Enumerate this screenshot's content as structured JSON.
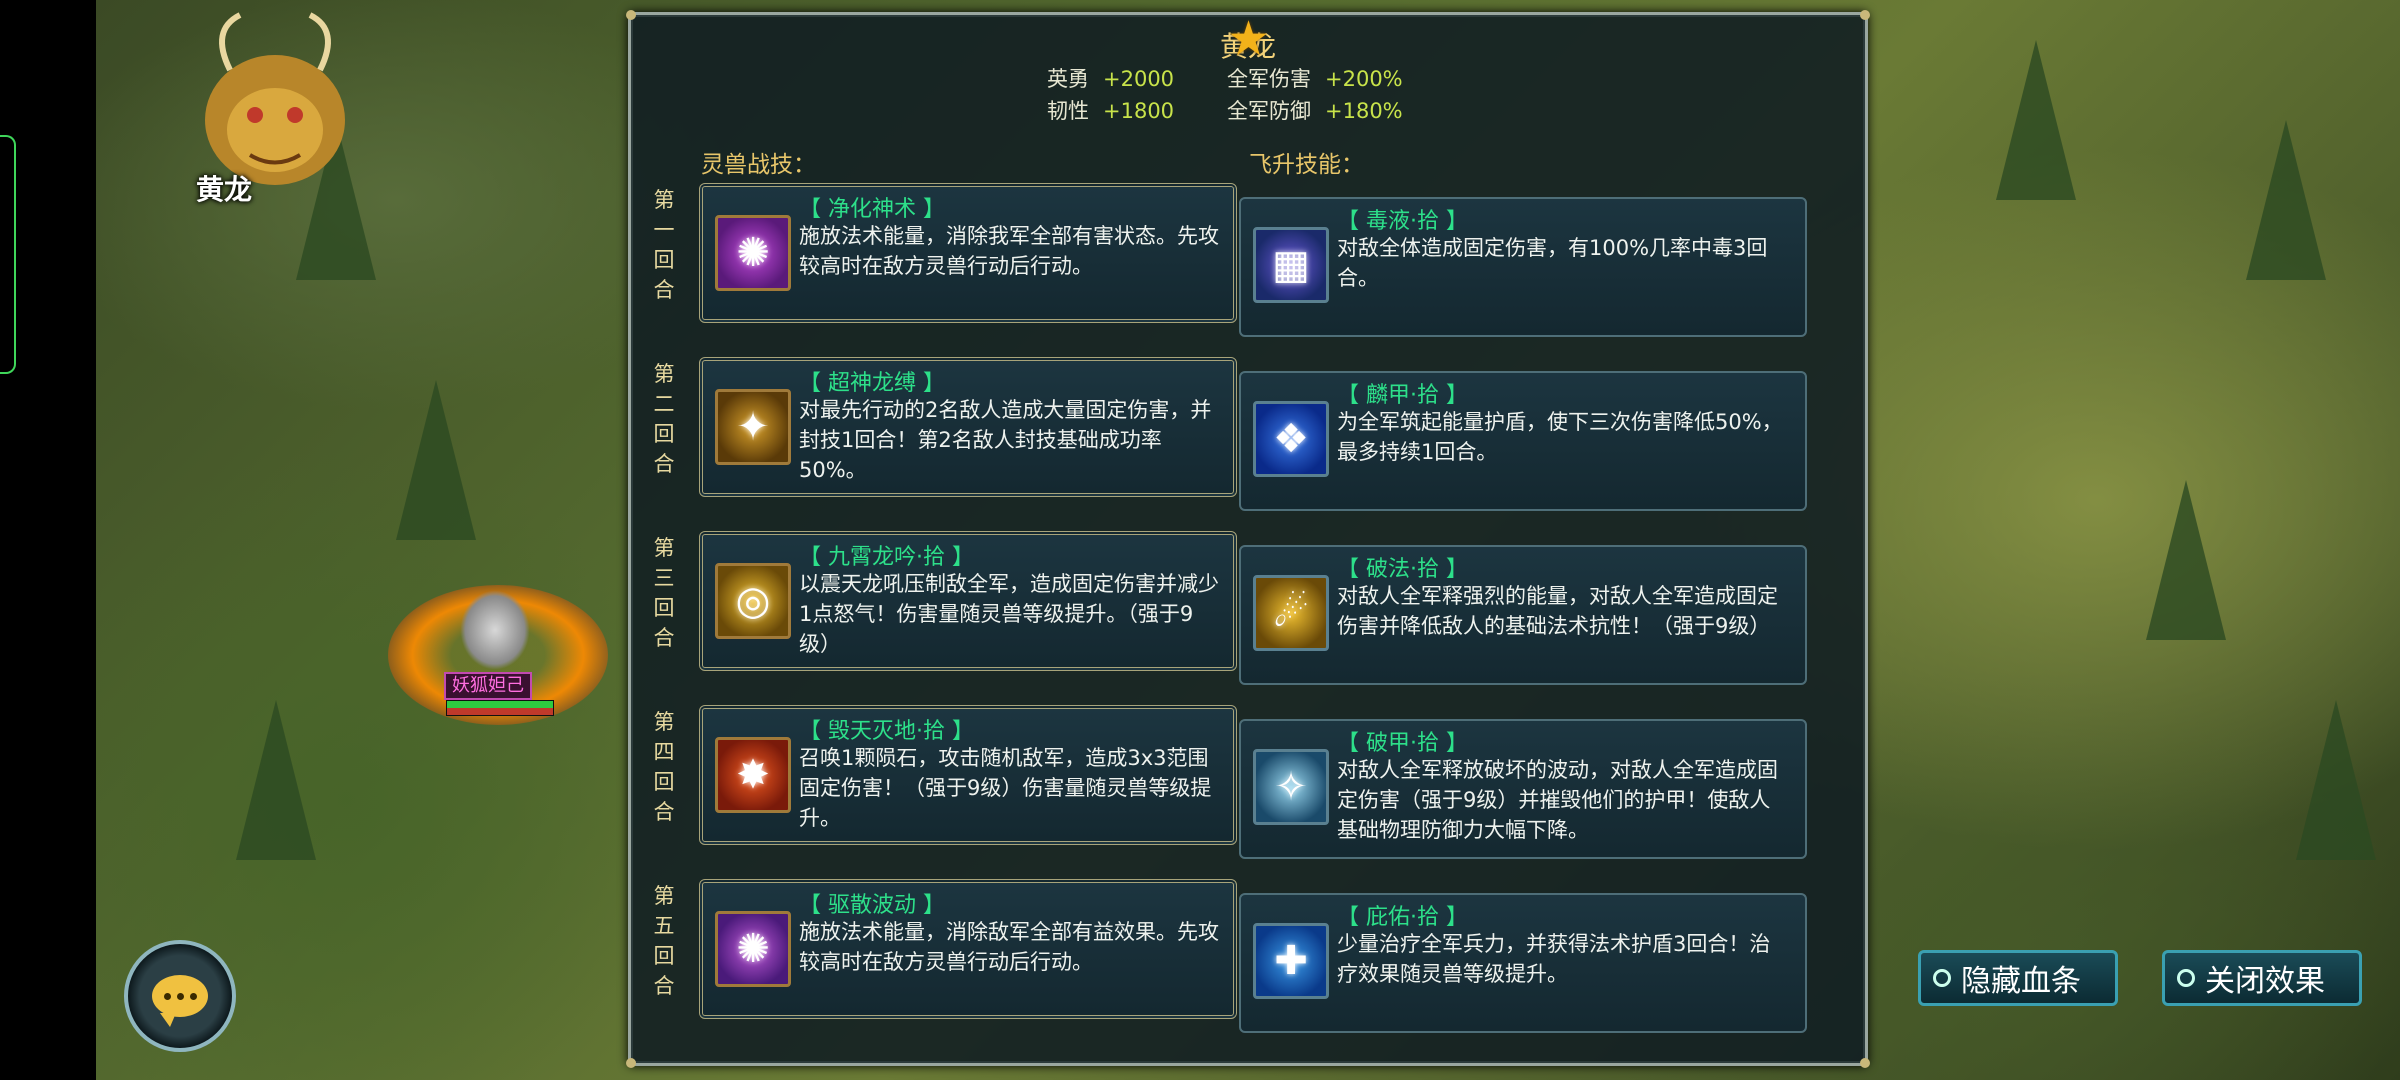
{
  "portrait": {
    "name": "黄龙"
  },
  "unit": {
    "label": "妖狐妲己"
  },
  "panel": {
    "title": "黄龙",
    "stats": [
      {
        "label": "英勇",
        "value": "+2000"
      },
      {
        "label": "全军伤害",
        "value": "+200%"
      },
      {
        "label": "韧性",
        "value": "+1800"
      },
      {
        "label": "全军防御",
        "value": "+180%"
      }
    ],
    "battle_label": "灵兽战技：",
    "ascend_label": "飞升技能：",
    "rounds": [
      {
        "round": [
          "第",
          "一",
          "回",
          "合"
        ],
        "battle": {
          "name": "【 净化神术 】",
          "desc": "施放法术能量，消除我军全部有害状态。先攻较高时在敌方灵兽行动后行动。"
        },
        "ascend": {
          "name": "【 毒液·拾 】",
          "desc": "对敌全体造成固定伤害，有100%几率中毒3回合。"
        }
      },
      {
        "round": [
          "第",
          "二",
          "回",
          "合"
        ],
        "battle": {
          "name": "【 超神龙缚 】",
          "desc": "对最先行动的2名敌人造成大量固定伤害，并封技1回合！第2名敌人封技基础成功率50%。"
        },
        "ascend": {
          "name": "【 麟甲·拾 】",
          "desc": "为全军筑起能量护盾，使下三次伤害降低50%，最多持续1回合。"
        }
      },
      {
        "round": [
          "第",
          "三",
          "回",
          "合"
        ],
        "battle": {
          "name": "【 九霄龙吟·拾 】",
          "desc": "以震天龙吼压制敌全军，造成固定伤害并减少1点怒气！伤害量随灵兽等级提升。（强于9级）"
        },
        "ascend": {
          "name": "【 破法·拾 】",
          "desc": "对敌人全军释强烈的能量，对敌人全军造成固定伤害并降低敌人的基础法术抗性！（强于9级）"
        }
      },
      {
        "round": [
          "第",
          "四",
          "回",
          "合"
        ],
        "battle": {
          "name": "【 毁天灭地·拾 】",
          "desc": "召唤1颗陨石，攻击随机敌军，造成3x3范围固定伤害！（强于9级）伤害量随灵兽等级提升。"
        },
        "ascend": {
          "name": "【 破甲·拾 】",
          "desc": "对敌人全军释放破坏的波动，对敌人全军造成固定伤害（强于9级）并摧毁他们的护甲！使敌人基础物理防御力大幅下降。"
        }
      },
      {
        "round": [
          "第",
          "五",
          "回",
          "合"
        ],
        "battle": {
          "name": "【 驱散波动 】",
          "desc": "施放法术能量，消除敌军全部有益效果。先攻较高时在敌方灵兽行动后行动。"
        },
        "ascend": {
          "name": "【 庇佑·拾 】",
          "desc": "少量治疗全军兵力，并获得法术护盾3回合！治疗效果随灵兽等级提升。"
        }
      }
    ]
  },
  "buttons": {
    "hide_hp": "隐藏血条",
    "close_effects": "关闭效果"
  },
  "colors": {
    "accent_gold": "#f2d27a",
    "skill_green": "#2de08a",
    "stat_green": "#c8e34a",
    "panel_bg": "#101c22"
  }
}
